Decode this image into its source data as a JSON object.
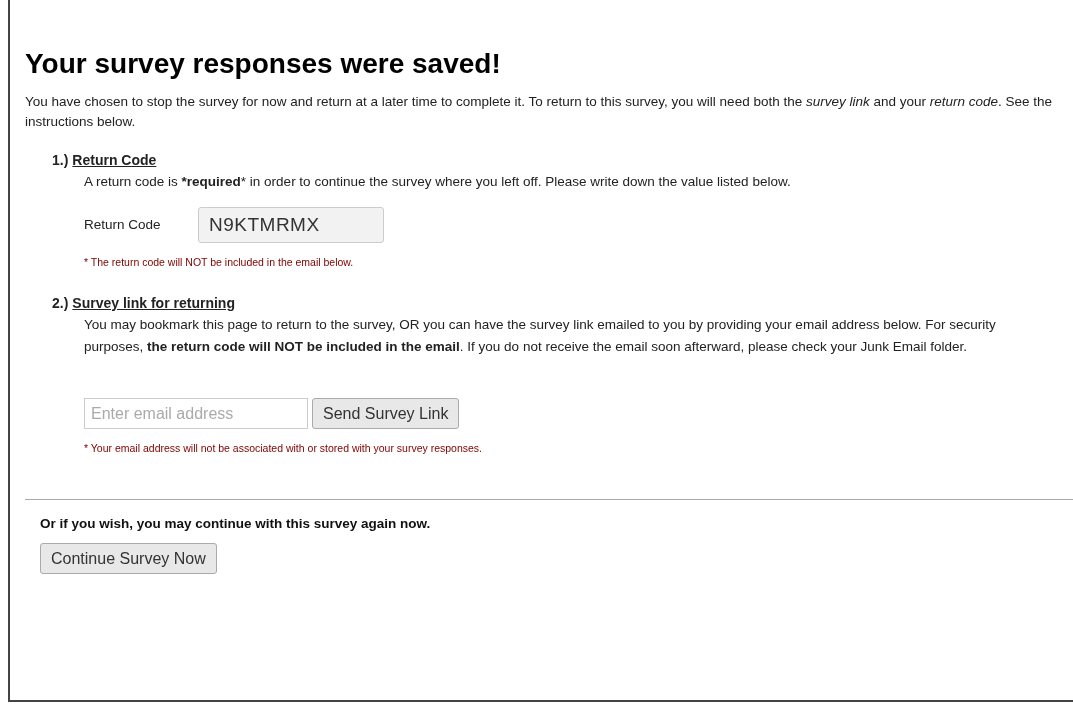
{
  "heading": "Your survey responses were saved!",
  "intro": "You have chosen to stop the survey for now and return at a later time to complete it. To return to this survey, you will need both the *survey link* and your *return code*. See the instructions below.",
  "sections": [
    {
      "kind": "code",
      "number": "1.)",
      "title": "Return Code",
      "text": "A return code is ***required*** in order to continue the survey where you left off. Please write down the value listed below.",
      "field_label": "Return Code",
      "value": "N9KTMRMX",
      "note": "* The return code will NOT be included in the email below."
    },
    {
      "kind": "email",
      "number": "2.)",
      "title": "Survey link for returning",
      "text": "You may bookmark this page to return to the survey, OR you can have the survey link emailed to you by providing your email address below. For security purposes, **the return code will NOT be included in the email**. If you do not receive the email soon afterward, please check your Junk Email folder.",
      "placeholder": "Enter email address",
      "button": "Send Survey Link",
      "note": "* Your email address will not be associated with or stored with your survey responses."
    }
  ],
  "continue_prompt": "Or if you wish, you may continue with this survey again now.",
  "continue_button": "Continue Survey Now"
}
